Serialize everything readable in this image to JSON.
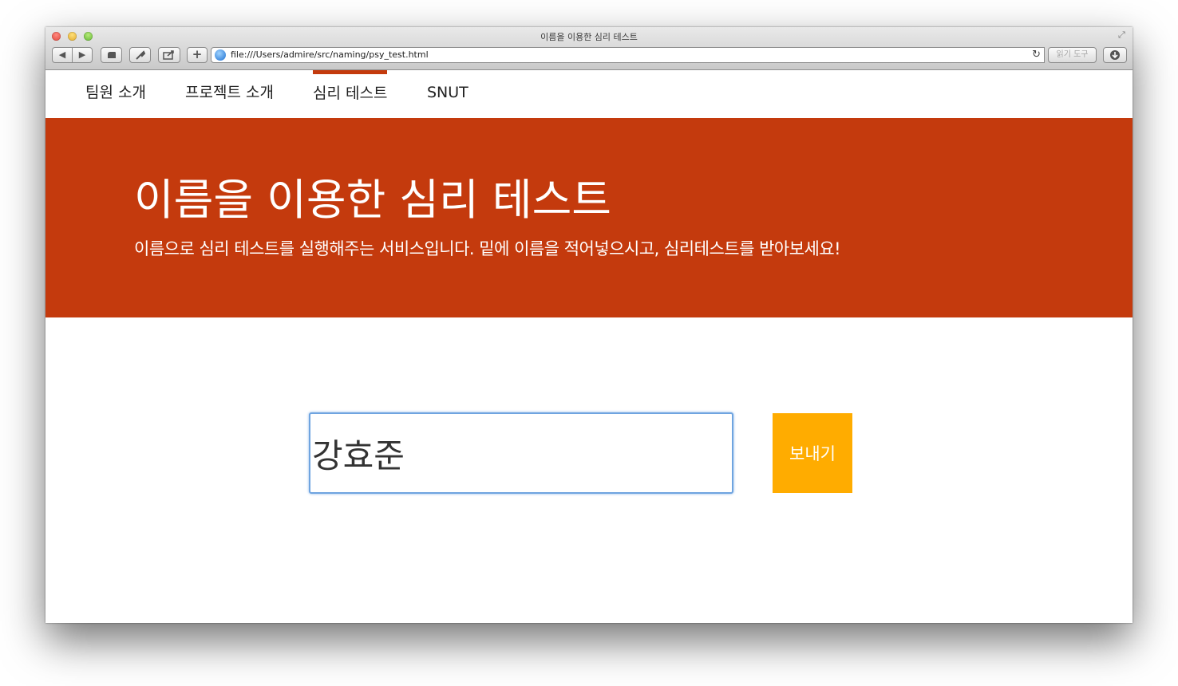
{
  "browser": {
    "window_title": "이름을 이용한 심리 테스트",
    "url": "file:///Users/admire/src/naming/psy_test.html",
    "reader_label": "읽기 도구",
    "icons": {
      "back": "◀",
      "forward": "▶",
      "add": "+",
      "reload": "↻",
      "fullscreen": "⤢"
    }
  },
  "nav": {
    "items": [
      {
        "label": "팀원 소개",
        "active": false
      },
      {
        "label": "프로젝트 소개",
        "active": false
      },
      {
        "label": "심리 테스트",
        "active": true
      },
      {
        "label": "SNUT",
        "active": false
      }
    ]
  },
  "hero": {
    "title": "이름을 이용한 심리 테스트",
    "subtitle": "이름으로 심리 테스트를 실행해주는 서비스입니다. 밑에 이름을 적어넣으시고, 심리테스트를 받아보세요!",
    "background_color": "#c43a0d"
  },
  "form": {
    "name_value": "강효준",
    "submit_label": "보내기",
    "submit_color": "#ffac00"
  }
}
